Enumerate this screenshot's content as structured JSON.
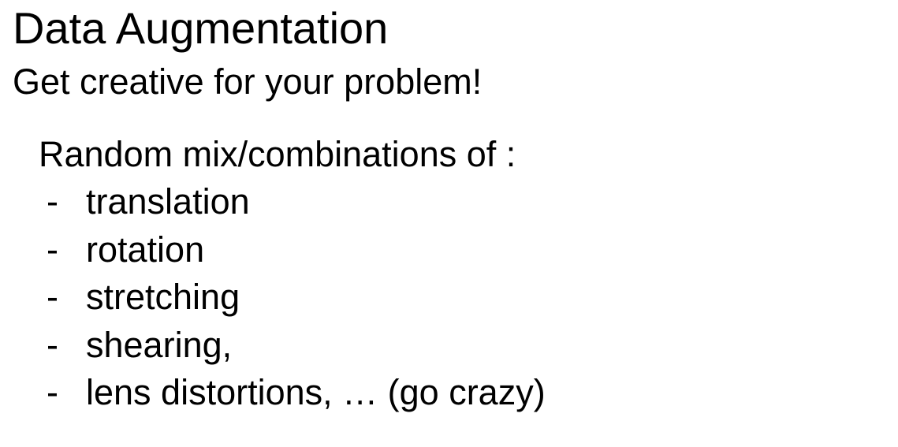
{
  "slide": {
    "title": "Data Augmentation",
    "subtitle": "Get creative for your problem!",
    "intro": "Random mix/combinations of :",
    "bullet_marker": "-",
    "bullets": [
      "translation",
      "rotation",
      "stretching",
      "shearing,",
      "lens distortions, …  (go crazy)"
    ]
  }
}
